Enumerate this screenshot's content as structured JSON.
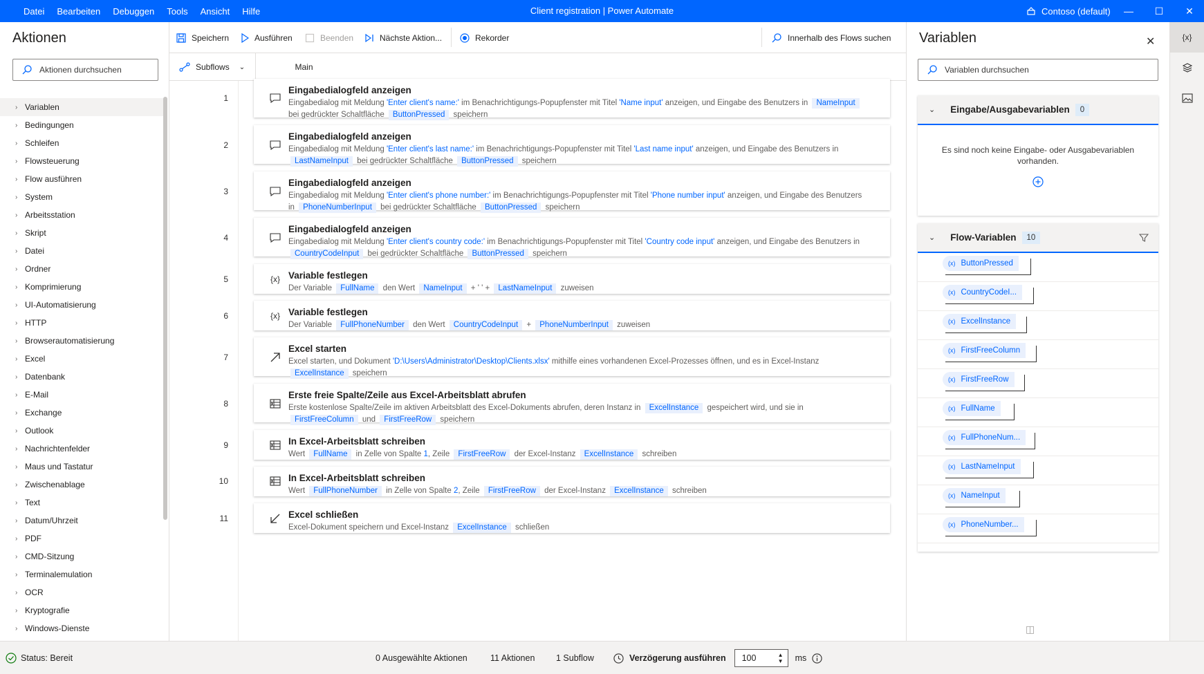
{
  "titlebar": {
    "menu": [
      "Datei",
      "Bearbeiten",
      "Debuggen",
      "Tools",
      "Ansicht",
      "Hilfe"
    ],
    "title": "Client registration | Power Automate",
    "environment": "Contoso (default)"
  },
  "actions_panel": {
    "title": "Aktionen",
    "search_placeholder": "Aktionen durchsuchen",
    "categories": [
      "Variablen",
      "Bedingungen",
      "Schleifen",
      "Flowsteuerung",
      "Flow ausführen",
      "System",
      "Arbeitsstation",
      "Skript",
      "Datei",
      "Ordner",
      "Komprimierung",
      "UI-Automatisierung",
      "HTTP",
      "Browserautomatisierung",
      "Excel",
      "Datenbank",
      "E-Mail",
      "Exchange",
      "Outlook",
      "Nachrichtenfelder",
      "Maus und Tastatur",
      "Zwischenablage",
      "Text",
      "Datum/Uhrzeit",
      "PDF",
      "CMD-Sitzung",
      "Terminalemulation",
      "OCR",
      "Kryptografie",
      "Windows-Dienste"
    ]
  },
  "toolbar": {
    "save": "Speichern",
    "run": "Ausführen",
    "stop": "Beenden",
    "next": "Nächste Aktion...",
    "recorder": "Rekorder",
    "search": "Innerhalb des Flows suchen"
  },
  "tabs": {
    "subflows": "Subflows",
    "main": "Main"
  },
  "steps": [
    {
      "n": "1",
      "title": "Eingabedialogfeld anzeigen",
      "icon": "message-icon",
      "parts": [
        [
          "t",
          "Eingabedialog mit Meldung "
        ],
        [
          "s",
          "'Enter client's name:'"
        ],
        [
          "t",
          " im Benachrichtigungs-Popupfenster mit Titel "
        ],
        [
          "s",
          "'Name input'"
        ],
        [
          "t",
          " anzeigen, und Eingabe des Benutzers in "
        ],
        [
          "p",
          "NameInput"
        ],
        [
          "t",
          " bei gedrückter Schaltfläche "
        ],
        [
          "p",
          "ButtonPressed"
        ],
        [
          "t",
          " speichern"
        ]
      ]
    },
    {
      "n": "2",
      "title": "Eingabedialogfeld anzeigen",
      "icon": "message-icon",
      "parts": [
        [
          "t",
          "Eingabedialog mit Meldung "
        ],
        [
          "s",
          "'Enter client's last name:'"
        ],
        [
          "t",
          " im Benachrichtigungs-Popupfenster mit Titel "
        ],
        [
          "s",
          "'Last name input'"
        ],
        [
          "t",
          " anzeigen, und Eingabe des Benutzers in "
        ],
        [
          "p",
          "LastNameInput"
        ],
        [
          "t",
          " bei gedrückter Schaltfläche "
        ],
        [
          "p",
          "ButtonPressed"
        ],
        [
          "t",
          " speichern"
        ]
      ]
    },
    {
      "n": "3",
      "title": "Eingabedialogfeld anzeigen",
      "icon": "message-icon",
      "parts": [
        [
          "t",
          "Eingabedialog mit Meldung "
        ],
        [
          "s",
          "'Enter client's phone number:'"
        ],
        [
          "t",
          " im Benachrichtigungs-Popupfenster mit Titel "
        ],
        [
          "s",
          "'Phone number input'"
        ],
        [
          "t",
          " anzeigen, und Eingabe des Benutzers in "
        ],
        [
          "p",
          "PhoneNumberInput"
        ],
        [
          "t",
          " bei gedrückter Schaltfläche "
        ],
        [
          "p",
          "ButtonPressed"
        ],
        [
          "t",
          " speichern"
        ]
      ]
    },
    {
      "n": "4",
      "title": "Eingabedialogfeld anzeigen",
      "icon": "message-icon",
      "parts": [
        [
          "t",
          "Eingabedialog mit Meldung "
        ],
        [
          "s",
          "'Enter client's country code:'"
        ],
        [
          "t",
          " im Benachrichtigungs-Popupfenster mit Titel "
        ],
        [
          "s",
          "'Country code input'"
        ],
        [
          "t",
          " anzeigen, und Eingabe des Benutzers in "
        ],
        [
          "p",
          "CountryCodeInput"
        ],
        [
          "t",
          " bei gedrückter Schaltfläche "
        ],
        [
          "p",
          "ButtonPressed"
        ],
        [
          "t",
          " speichern"
        ]
      ]
    },
    {
      "n": "5",
      "title": "Variable festlegen",
      "icon": "variable-icon",
      "parts": [
        [
          "t",
          "Der Variable "
        ],
        [
          "p",
          "FullName"
        ],
        [
          "t",
          " den Wert "
        ],
        [
          "p",
          "NameInput"
        ],
        [
          "t",
          " + ' ' + "
        ],
        [
          "p",
          "LastNameInput"
        ],
        [
          "t",
          " zuweisen"
        ]
      ]
    },
    {
      "n": "6",
      "title": "Variable festlegen",
      "icon": "variable-icon",
      "parts": [
        [
          "t",
          "Der Variable "
        ],
        [
          "p",
          "FullPhoneNumber"
        ],
        [
          "t",
          " den Wert "
        ],
        [
          "p",
          "CountryCodeInput"
        ],
        [
          "t",
          " + "
        ],
        [
          "p",
          "PhoneNumberInput"
        ],
        [
          "t",
          " zuweisen"
        ]
      ]
    },
    {
      "n": "7",
      "title": "Excel starten",
      "icon": "arrow-launch-icon",
      "parts": [
        [
          "t",
          "Excel starten, und Dokument "
        ],
        [
          "s",
          "'D:\\Users\\Administrator\\Desktop\\Clients.xlsx'"
        ],
        [
          "t",
          " mithilfe eines vorhandenen Excel-Prozesses öffnen, und es in Excel-Instanz "
        ],
        [
          "p",
          "ExcelInstance"
        ],
        [
          "t",
          " speichern"
        ]
      ]
    },
    {
      "n": "8",
      "title": "Erste freie Spalte/Zeile aus Excel-Arbeitsblatt abrufen",
      "icon": "excel-icon",
      "parts": [
        [
          "t",
          "Erste kostenlose Spalte/Zeile im aktiven Arbeitsblatt des Excel-Dokuments abrufen, deren Instanz in "
        ],
        [
          "p",
          "ExcelInstance"
        ],
        [
          "t",
          " gespeichert wird, und sie in "
        ],
        [
          "p",
          "FirstFreeColumn"
        ],
        [
          "t",
          " und "
        ],
        [
          "p",
          "FirstFreeRow"
        ],
        [
          "t",
          " speichern"
        ]
      ]
    },
    {
      "n": "9",
      "title": "In Excel-Arbeitsblatt schreiben",
      "icon": "excel-icon",
      "parts": [
        [
          "t",
          "Wert "
        ],
        [
          "p",
          "FullName"
        ],
        [
          "t",
          " in Zelle von Spalte "
        ],
        [
          "s",
          "1"
        ],
        [
          "t",
          ", Zeile "
        ],
        [
          "p",
          "FirstFreeRow"
        ],
        [
          "t",
          " der Excel-Instanz "
        ],
        [
          "p",
          "ExcelInstance"
        ],
        [
          "t",
          " schreiben"
        ]
      ]
    },
    {
      "n": "10",
      "title": "In Excel-Arbeitsblatt schreiben",
      "icon": "excel-icon",
      "parts": [
        [
          "t",
          "Wert "
        ],
        [
          "p",
          "FullPhoneNumber"
        ],
        [
          "t",
          " in Zelle von Spalte "
        ],
        [
          "s",
          "2"
        ],
        [
          "t",
          ", Zeile "
        ],
        [
          "p",
          "FirstFreeRow"
        ],
        [
          "t",
          " der Excel-Instanz "
        ],
        [
          "p",
          "ExcelInstance"
        ],
        [
          "t",
          " schreiben"
        ]
      ]
    },
    {
      "n": "11",
      "title": "Excel schließen",
      "icon": "arrow-close-icon",
      "parts": [
        [
          "t",
          "Excel-Dokument speichern und Excel-Instanz "
        ],
        [
          "p",
          "ExcelInstance"
        ],
        [
          "t",
          " schließen"
        ]
      ]
    }
  ],
  "variables_panel": {
    "title": "Variablen",
    "search_placeholder": "Variablen durchsuchen",
    "io_group": {
      "label": "Eingabe/Ausgabevariablen",
      "count": "0",
      "empty_text": "Es sind noch keine Eingabe- oder Ausgabevariablen vorhanden."
    },
    "flow_group": {
      "label": "Flow-Variablen",
      "count": "10"
    },
    "variables": [
      "ButtonPressed",
      "CountryCodeI...",
      "ExcelInstance",
      "FirstFreeColumn",
      "FirstFreeRow",
      "FullName",
      "FullPhoneNum...",
      "LastNameInput",
      "NameInput",
      "PhoneNumber..."
    ]
  },
  "rail": {
    "variables_label": "{x}"
  },
  "statusbar": {
    "status": "Status: Bereit",
    "selected": "0 Ausgewählte Aktionen",
    "actions": "11 Aktionen",
    "subflows": "1 Subflow",
    "delay_label": "Verzögerung ausführen",
    "delay_value": "100",
    "delay_unit": "ms"
  },
  "colors": {
    "accent": "#0066ff",
    "status_ok": "#107c10"
  }
}
